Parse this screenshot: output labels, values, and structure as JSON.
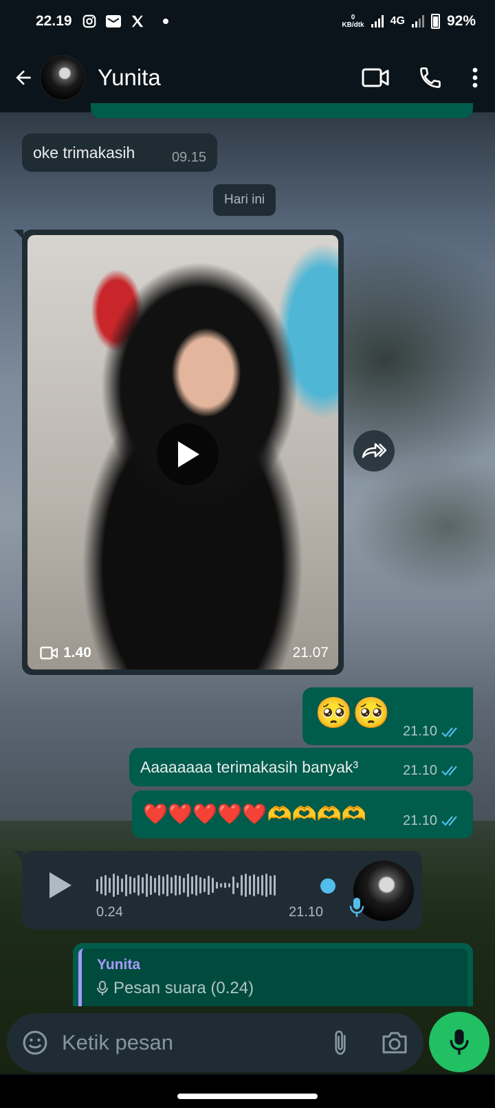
{
  "status": {
    "time": "22.19",
    "net_speed_value": "0",
    "net_speed_unit": "KB/dtk",
    "network_type": "4G",
    "battery": "92%"
  },
  "header": {
    "contact_name": "Yunita"
  },
  "messages": {
    "m1_text": "oke trimakasih",
    "m1_time": "09.15",
    "date_chip": "Hari ini",
    "video_duration": "1.40",
    "video_time": "21.07",
    "m3_text": "🥺🥺",
    "m3_time": "21.10",
    "m4_text": "Aaaaaaaa terimakasih banyak³",
    "m4_time": "21.10",
    "m5_text": "❤️❤️❤️❤️❤️🫶🫶🫶🫶",
    "m5_time": "21.10",
    "voice_duration": "0.24",
    "voice_time": "21.10",
    "voice_progress": 0.97
  },
  "reply": {
    "name": "Yunita",
    "text": "Pesan suara (0.24)"
  },
  "composer": {
    "placeholder": "Ketik pesan"
  },
  "colors": {
    "incoming": "#202c33",
    "outgoing": "#005c4b",
    "accent_green": "#21c063",
    "read_ticks": "#53bdeb",
    "reply_name": "#a79bfd"
  }
}
